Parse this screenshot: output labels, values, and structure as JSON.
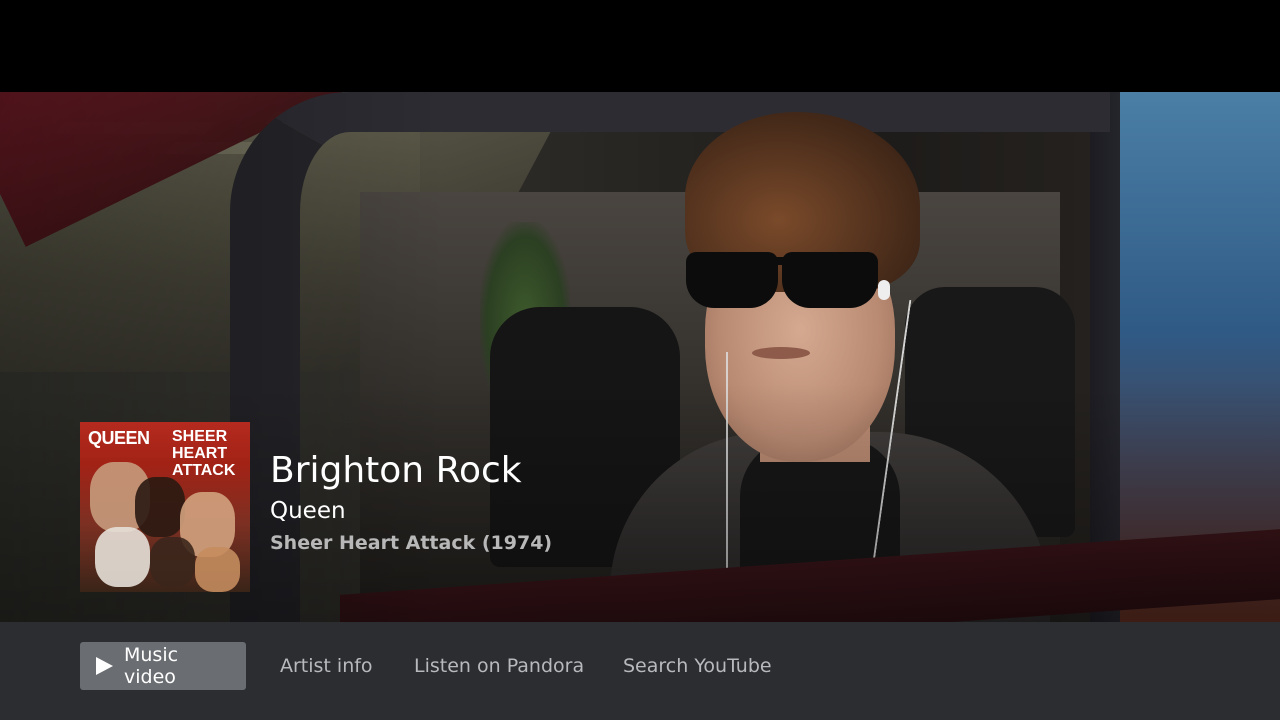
{
  "now_playing": {
    "title": "Brighton Rock",
    "artist": "Queen",
    "album": "Sheer Heart Attack (1974)",
    "album_art": {
      "band_text": "QUEEN",
      "album_text_lines": [
        "SHEER",
        "HEART",
        "ATTACK"
      ]
    }
  },
  "actions": [
    {
      "label": "Music video",
      "icon": "play-icon",
      "selected": true
    },
    {
      "label": "Artist info",
      "selected": false
    },
    {
      "label": "Listen on Pandora",
      "selected": false
    },
    {
      "label": "Search YouTube",
      "selected": false
    }
  ],
  "colors": {
    "action_bar_bg": "#2b2d30",
    "selected_button_bg": "#6a6d71",
    "album_subtitle": "#b8b8b8",
    "letterbox": "#000000"
  }
}
